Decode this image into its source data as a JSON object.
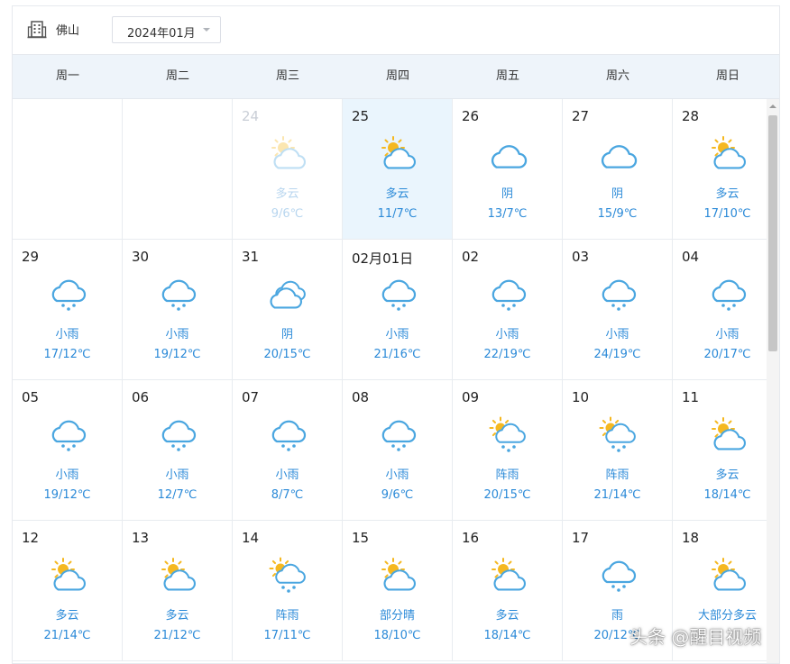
{
  "header": {
    "city": "佛山",
    "month_value": "2024年01月"
  },
  "weekdays": [
    "周一",
    "周二",
    "周三",
    "周四",
    "周五",
    "周六",
    "周日"
  ],
  "days": [
    {
      "day": "",
      "cond": "",
      "temp": "",
      "icon": "none",
      "state": "empty"
    },
    {
      "day": "",
      "cond": "",
      "temp": "",
      "icon": "none",
      "state": "empty"
    },
    {
      "day": "24",
      "cond": "多云",
      "temp": "9/6℃",
      "icon": "partly-cloudy-icon",
      "state": "past"
    },
    {
      "day": "25",
      "cond": "多云",
      "temp": "11/7℃",
      "icon": "partly-cloudy-icon",
      "state": "today"
    },
    {
      "day": "26",
      "cond": "阴",
      "temp": "13/7℃",
      "icon": "cloud-icon",
      "state": "normal"
    },
    {
      "day": "27",
      "cond": "阴",
      "temp": "15/9℃",
      "icon": "cloud-icon",
      "state": "normal"
    },
    {
      "day": "28",
      "cond": "多云",
      "temp": "17/10℃",
      "icon": "partly-cloudy-icon",
      "state": "normal"
    },
    {
      "day": "29",
      "cond": "小雨",
      "temp": "17/12℃",
      "icon": "light-rain-icon",
      "state": "normal"
    },
    {
      "day": "30",
      "cond": "小雨",
      "temp": "19/12℃",
      "icon": "light-rain-icon",
      "state": "normal"
    },
    {
      "day": "31",
      "cond": "阴",
      "temp": "20/15℃",
      "icon": "overcast-icon",
      "state": "normal"
    },
    {
      "day": "02月01日",
      "cond": "小雨",
      "temp": "21/16℃",
      "icon": "light-rain-icon",
      "state": "normal"
    },
    {
      "day": "02",
      "cond": "小雨",
      "temp": "22/19℃",
      "icon": "light-rain-icon",
      "state": "normal"
    },
    {
      "day": "03",
      "cond": "小雨",
      "temp": "24/19℃",
      "icon": "light-rain-icon",
      "state": "normal"
    },
    {
      "day": "04",
      "cond": "小雨",
      "temp": "20/17℃",
      "icon": "light-rain-icon",
      "state": "normal"
    },
    {
      "day": "05",
      "cond": "小雨",
      "temp": "19/12℃",
      "icon": "light-rain-icon",
      "state": "normal"
    },
    {
      "day": "06",
      "cond": "小雨",
      "temp": "12/7℃",
      "icon": "light-rain-icon",
      "state": "normal"
    },
    {
      "day": "07",
      "cond": "小雨",
      "temp": "8/7℃",
      "icon": "light-rain-icon",
      "state": "normal"
    },
    {
      "day": "08",
      "cond": "小雨",
      "temp": "9/6℃",
      "icon": "light-rain-icon",
      "state": "normal"
    },
    {
      "day": "09",
      "cond": "阵雨",
      "temp": "20/15℃",
      "icon": "shower-icon",
      "state": "normal"
    },
    {
      "day": "10",
      "cond": "阵雨",
      "temp": "21/14℃",
      "icon": "shower-icon",
      "state": "normal"
    },
    {
      "day": "11",
      "cond": "多云",
      "temp": "18/14℃",
      "icon": "partly-cloudy-icon",
      "state": "normal"
    },
    {
      "day": "12",
      "cond": "多云",
      "temp": "21/14℃",
      "icon": "partly-cloudy-icon",
      "state": "normal"
    },
    {
      "day": "13",
      "cond": "多云",
      "temp": "21/12℃",
      "icon": "partly-cloudy-icon",
      "state": "normal"
    },
    {
      "day": "14",
      "cond": "阵雨",
      "temp": "17/11℃",
      "icon": "shower-icon",
      "state": "normal"
    },
    {
      "day": "15",
      "cond": "部分晴",
      "temp": "18/10℃",
      "icon": "partly-cloudy-icon",
      "state": "normal"
    },
    {
      "day": "16",
      "cond": "多云",
      "temp": "18/14℃",
      "icon": "partly-cloudy-icon",
      "state": "normal"
    },
    {
      "day": "17",
      "cond": "雨",
      "temp": "20/12℃",
      "icon": "rain-icon",
      "state": "normal"
    },
    {
      "day": "18",
      "cond": "大部分多云",
      "temp": "",
      "icon": "partly-cloudy-icon",
      "state": "normal"
    }
  ],
  "watermark": "头条 @醒目视频",
  "colors": {
    "accent": "#2b8ad8",
    "sun": "#f5b820",
    "cloud": "#4aa6e0",
    "header_bg": "#eef4fa",
    "today_bg": "#eaf5fd"
  }
}
